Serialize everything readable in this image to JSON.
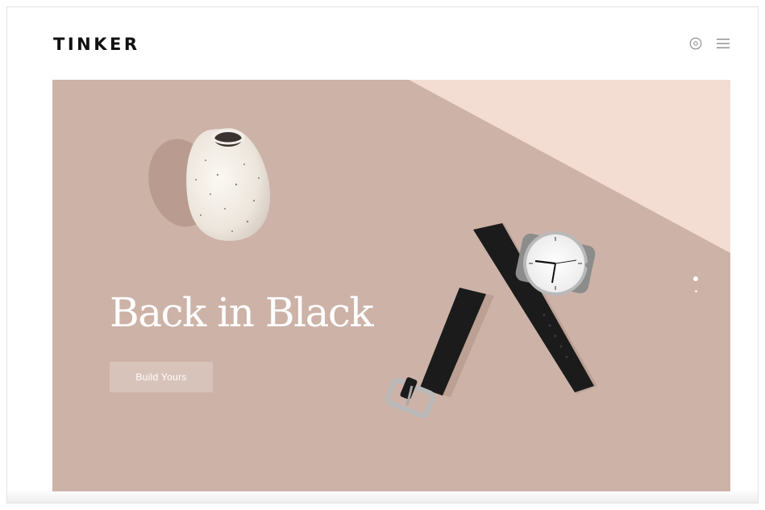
{
  "brand": {
    "logo": "TINKER"
  },
  "header": {
    "icons": [
      "cart-icon",
      "menu-icon"
    ]
  },
  "hero": {
    "title": "Back in Black",
    "cta_label": "Build Yours",
    "slides": {
      "count": 2,
      "active": 1
    }
  },
  "colors": {
    "hero_background": "#cdb2a7",
    "hero_highlight": "#f3ddd3",
    "text_light": "#ffffff",
    "logo_text": "#111111"
  }
}
